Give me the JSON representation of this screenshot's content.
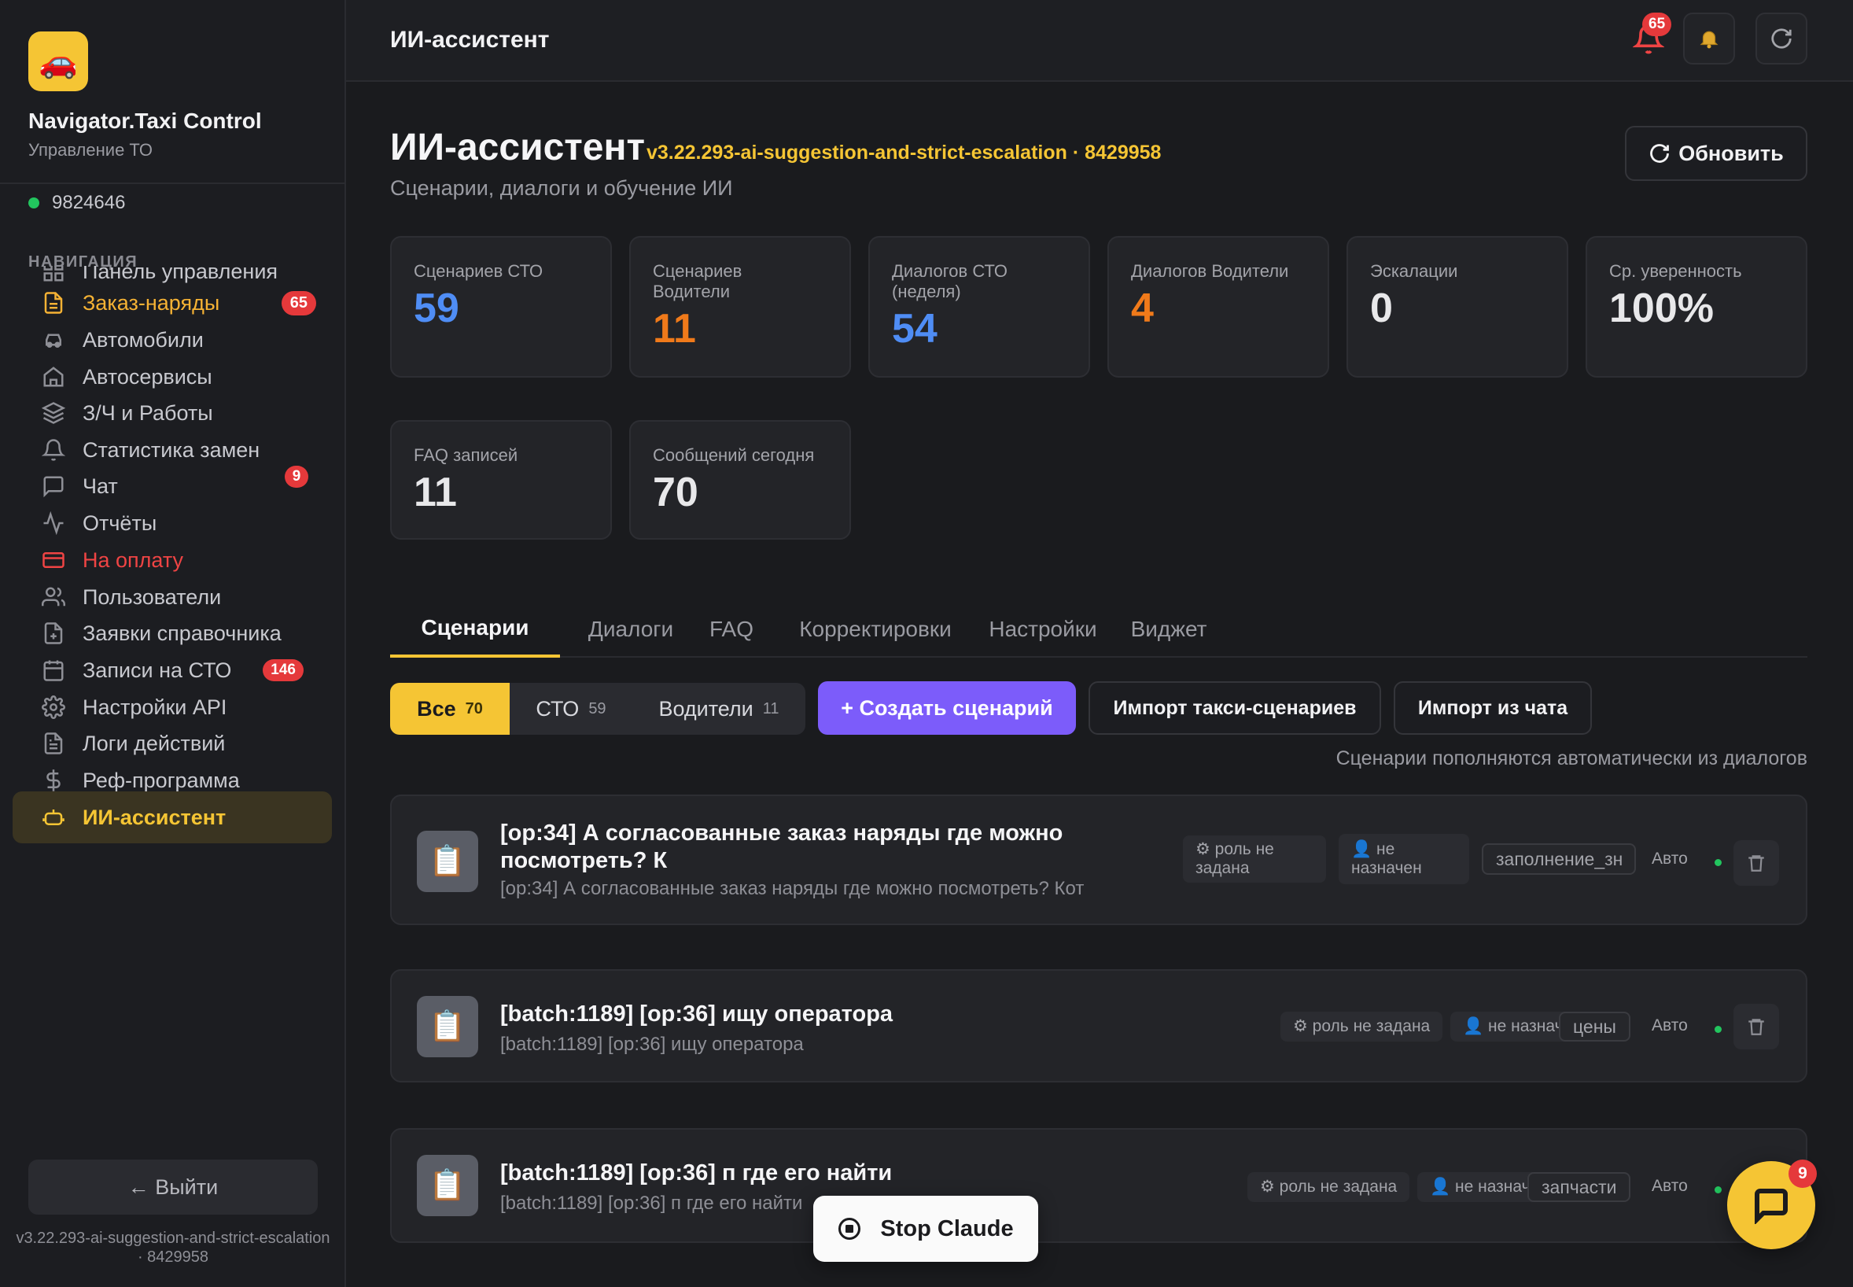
{
  "sidebar": {
    "brand_name": "Navigator.Taxi Control",
    "brand_sub": "Управление ТО",
    "user_id": "9824646",
    "nav_heading": "НАВИГАЦИЯ",
    "items": [
      {
        "label": "Панель управления",
        "icon": "grid-icon"
      },
      {
        "label": "Заказ-наряды",
        "icon": "document-icon",
        "badge": "65"
      },
      {
        "label": "Автомобили",
        "icon": "car-icon"
      },
      {
        "label": "Автосервисы",
        "icon": "building-icon"
      },
      {
        "label": "З/Ч и Работы",
        "icon": "layers-icon"
      },
      {
        "label": "Статистика замен",
        "icon": "bell-icon"
      },
      {
        "label": "Чат",
        "icon": "message-icon",
        "badge": "9"
      },
      {
        "label": "Отчёты",
        "icon": "activity-icon"
      },
      {
        "label": "На оплату",
        "icon": "credit-card-icon"
      },
      {
        "label": "Пользователи",
        "icon": "users-icon"
      },
      {
        "label": "Заявки справочника",
        "icon": "file-plus-icon"
      },
      {
        "label": "Записи на СТО",
        "icon": "calendar-icon",
        "badge": "146"
      },
      {
        "label": "Настройки API",
        "icon": "gear-icon"
      },
      {
        "label": "Логи действий",
        "icon": "file-text-icon"
      },
      {
        "label": "Реф-программа",
        "icon": "dollar-icon"
      },
      {
        "label": "ИИ-ассистент",
        "icon": "bot-icon"
      }
    ],
    "logout_label": "← Выйти",
    "version": "v3.22.293-ai-suggestion-and-strict-escalation · 8429958"
  },
  "topbar": {
    "title": "ИИ-ассистент",
    "notif_badge": "65"
  },
  "page": {
    "title": "ИИ-ассистент",
    "version": "v3.22.293-ai-suggestion-and-strict-escalation · 8429958",
    "subtitle": "Сценарии, диалоги и обучение ИИ",
    "refresh_label": "Обновить"
  },
  "stats": [
    {
      "label": "Сценариев СТО",
      "value": "59",
      "color": "#4f8df5"
    },
    {
      "label": "Сценариев Водители",
      "value": "11",
      "color": "#f07a1a"
    },
    {
      "label": "Диалогов СТО (неделя)",
      "value": "54",
      "color": "#4f8df5"
    },
    {
      "label": "Диалогов Водители",
      "value": "4",
      "color": "#f07a1a"
    },
    {
      "label": "Эскалации",
      "value": "0",
      "color": "#f2f2f4"
    },
    {
      "label": "Ср. уверенность",
      "value": "100%",
      "color": "#f2f2f4"
    },
    {
      "label": "FAQ записей",
      "value": "11",
      "color": "#f2f2f4"
    },
    {
      "label": "Сообщений сегодня",
      "value": "70",
      "color": "#f2f2f4"
    }
  ],
  "tabs": [
    "Сценарии",
    "Диалоги",
    "FAQ",
    "Корректировки",
    "Настройки",
    "Виджет"
  ],
  "filters": [
    {
      "label": "Все",
      "count": "70"
    },
    {
      "label": "СТО",
      "count": "59"
    },
    {
      "label": "Водители",
      "count": "11"
    }
  ],
  "actions": {
    "create": "+ Создать сценарий",
    "import_taxi": "Импорт такси-сценариев",
    "import_chat": "Импорт из чата"
  },
  "hint": "Сценарии пополняются автоматически из диалогов",
  "scenarios": [
    {
      "title": "[op:34] А согласованные заказ наряды где можно посмотреть? К",
      "desc": "[op:34] А согласованные заказ наряды где можно посмотреть? Кот",
      "role": "⚙ роль не задана",
      "assignee": "👤 не назначен",
      "tag": "заполнение_зн",
      "source": "Авто"
    },
    {
      "title": "[batch:1189] [op:36] ищу оператора",
      "desc": "[batch:1189] [op:36] ищу оператора",
      "role": "⚙ роль не задана",
      "assignee": "👤 не назначен",
      "tag": "цены",
      "source": "Авто"
    },
    {
      "title": "[batch:1189] [op:36] п где его найти",
      "desc": "[batch:1189] [op:36] п где его найти",
      "role": "⚙ роль не задана",
      "assignee": "👤 не назначен",
      "tag": "запчасти",
      "source": "Авто"
    }
  ],
  "overlay": {
    "stop_label": "Stop Claude",
    "chat_badge": "9"
  }
}
